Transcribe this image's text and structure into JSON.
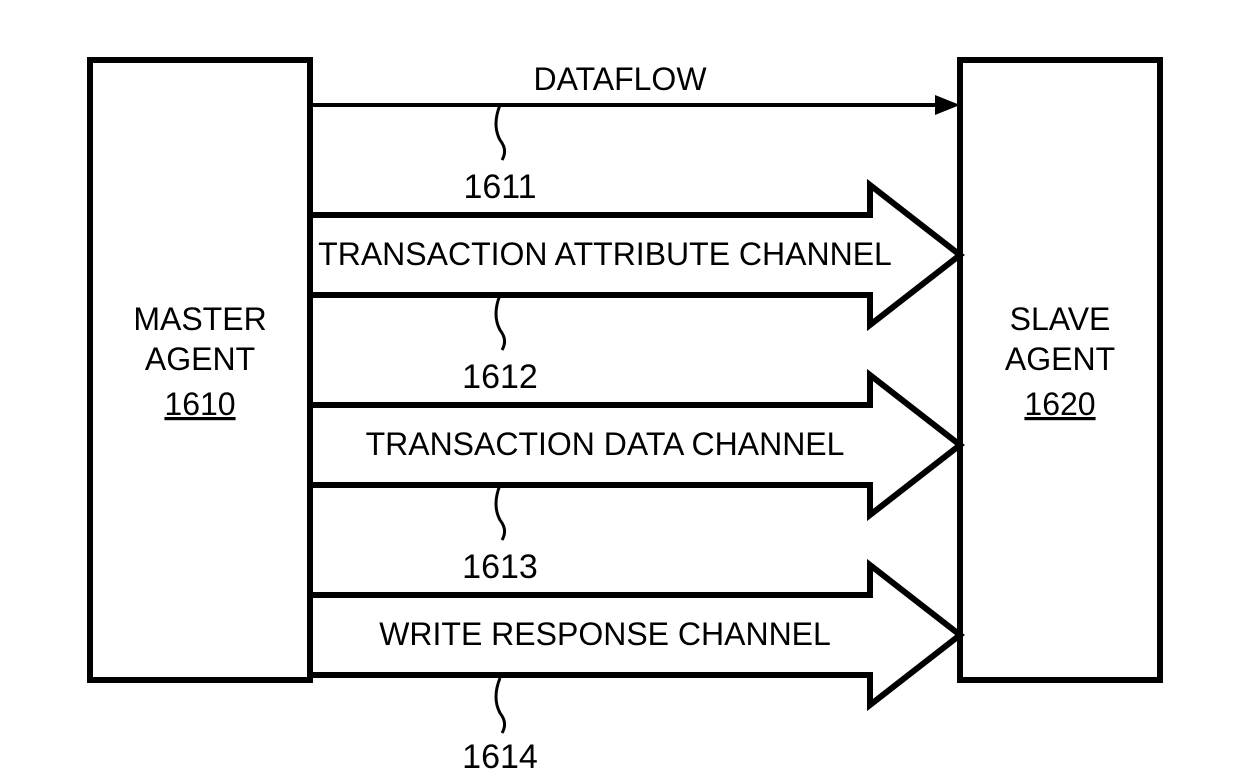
{
  "left_box": {
    "title": "MASTER",
    "subtitle": "AGENT",
    "ref": "1610"
  },
  "right_box": {
    "title": "SLAVE",
    "subtitle": "AGENT",
    "ref": "1620"
  },
  "dataflow": {
    "label": "DATAFLOW",
    "ref": "1611"
  },
  "channels": [
    {
      "label": "TRANSACTION ATTRIBUTE CHANNEL",
      "ref": "1612"
    },
    {
      "label": "TRANSACTION DATA CHANNEL",
      "ref": "1613"
    },
    {
      "label": "WRITE RESPONSE CHANNEL",
      "ref": "1614"
    }
  ]
}
